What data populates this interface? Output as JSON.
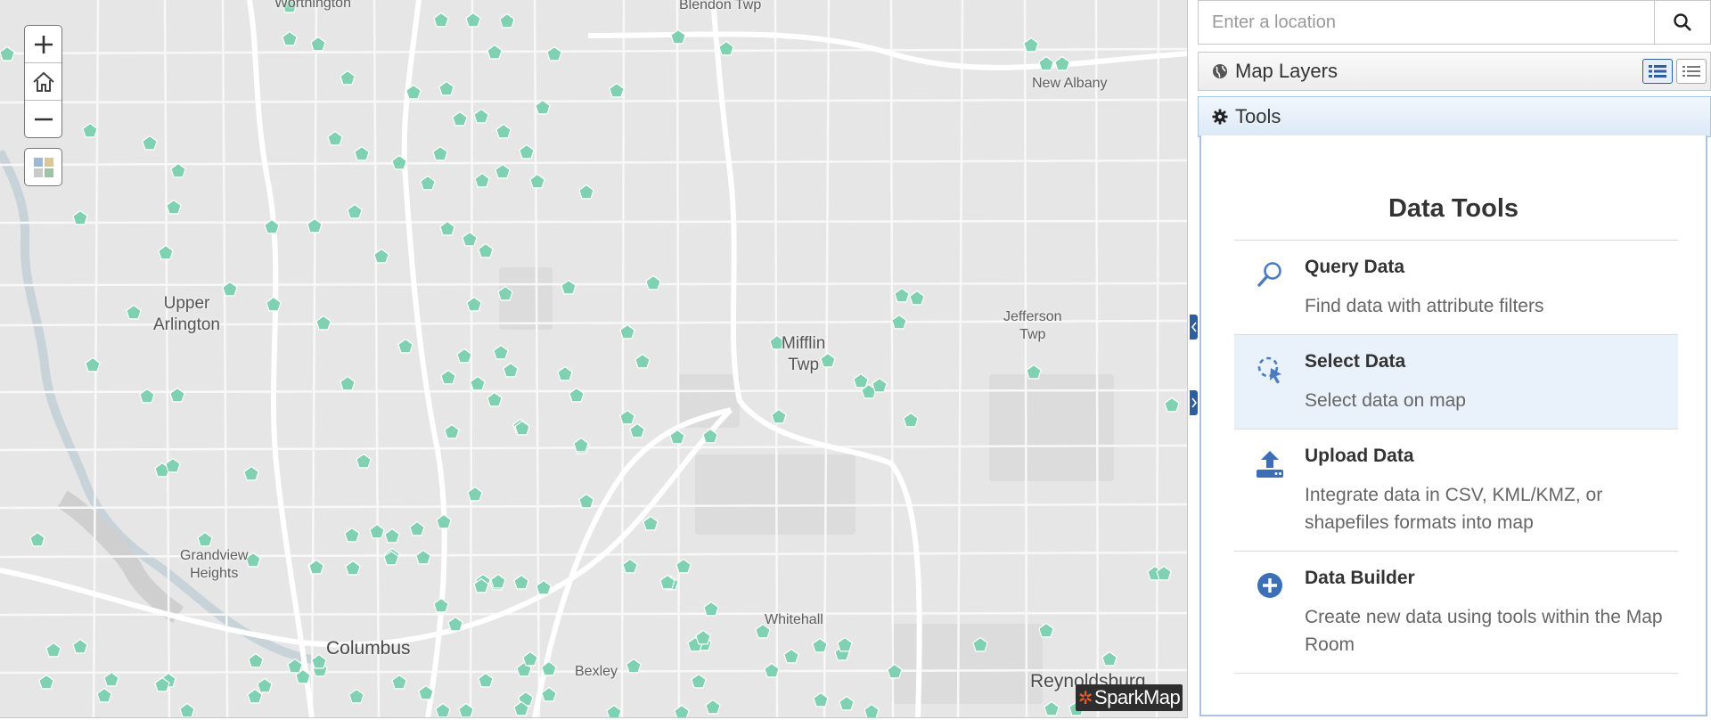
{
  "map": {
    "places": [
      {
        "label": "Worthington",
        "cls": "small"
      },
      {
        "label": "Blendon Twp",
        "cls": "small"
      },
      {
        "label": "New Albany",
        "cls": "small"
      },
      {
        "label": "Upper\nArlington",
        "cls": ""
      },
      {
        "label": "Mifflin\nTwp",
        "cls": ""
      },
      {
        "label": "Jefferson\nTwp",
        "cls": "small"
      },
      {
        "label": "Grandview\nHeights",
        "cls": "small"
      },
      {
        "label": "Columbus",
        "cls": "big"
      },
      {
        "label": "Bexley",
        "cls": "small"
      },
      {
        "label": "Whitehall",
        "cls": "small"
      },
      {
        "label": "Reynoldsburg",
        "cls": "big"
      }
    ],
    "controls": {
      "zoom_in": "zoom-in",
      "home": "home",
      "zoom_out": "zoom-out",
      "basemap": "basemap-gallery"
    },
    "marker_color": "#7fd1b1",
    "logo": "SparkMap"
  },
  "panel": {
    "search": {
      "placeholder": "Enter a location",
      "value": ""
    },
    "layers_header": "Map Layers",
    "tools_header": "Tools",
    "tools_title": "Data Tools",
    "tools": [
      {
        "name": "Query Data",
        "desc": "Find data with attribute filters",
        "icon": "magnifier-icon"
      },
      {
        "name": "Select Data",
        "desc": "Select data on map",
        "icon": "select-cursor-icon"
      },
      {
        "name": "Upload Data",
        "desc": "Integrate data in CSV, KML/KMZ, or shapefiles formats into map",
        "icon": "upload-icon"
      },
      {
        "name": "Data Builder",
        "desc": "Create new data using tools within the Map Room",
        "icon": "plus-circle-icon"
      }
    ],
    "accent": "#2d5fa0"
  }
}
